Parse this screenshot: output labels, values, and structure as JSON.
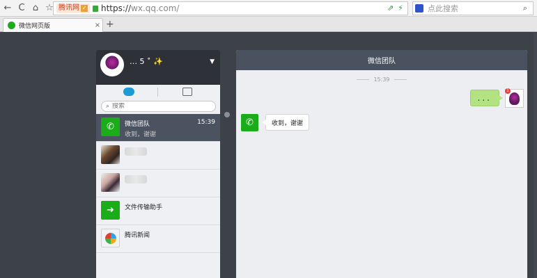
{
  "browser": {
    "site_name": "腾讯网",
    "url_scheme": "https://",
    "url_host": "wx.qq.com/",
    "search_placeholder": "点此搜索",
    "tab_title": "微信网页版",
    "new_tab_symbol": "+",
    "close_symbol": "×",
    "back_symbol": "←",
    "forward_symbol": "→",
    "refresh_symbol": "C",
    "home_symbol": "⌂",
    "star_symbol": "☆"
  },
  "profile": {
    "nickname": "… 5 ˚ ✨",
    "dropdown_symbol": "▼"
  },
  "sidebar": {
    "search_placeholder": "搜索",
    "conversations": [
      {
        "name": "微信团队",
        "last_message": "收到，谢谢",
        "time": "15:39",
        "avatar": "wechat-logo",
        "active": true
      },
      {
        "name": "",
        "last_message": "",
        "time": "",
        "avatar": "photo",
        "active": false
      },
      {
        "name": "",
        "last_message": "",
        "time": "",
        "avatar": "photo",
        "active": false
      },
      {
        "name": "文件传输助手",
        "last_message": "",
        "time": "",
        "avatar": "file-transfer",
        "active": false
      },
      {
        "name": "腾讯新闻",
        "last_message": "",
        "time": "",
        "avatar": "tencent-news",
        "active": false
      }
    ]
  },
  "chat": {
    "title": "微信团队",
    "timestamp": "15:39",
    "outgoing_message": "...",
    "unread_badge": "1",
    "incoming_message": "收到，谢谢"
  },
  "colors": {
    "accent_green": "#1aad19",
    "bubble_out": "#b2e281",
    "header_dark": "#4a5260"
  }
}
